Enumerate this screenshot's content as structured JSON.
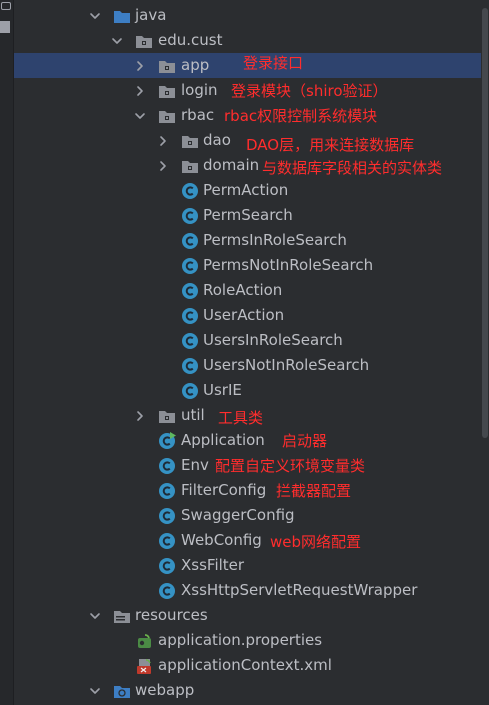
{
  "tree": {
    "java": "java",
    "edu_cust": "edu.cust",
    "app": "app",
    "login": "login",
    "rbac": "rbac",
    "dao": "dao",
    "domain": "domain",
    "rbac_classes": [
      "PermAction",
      "PermSearch",
      "PermsInRoleSearch",
      "PermsNotInRoleSearch",
      "RoleAction",
      "UserAction",
      "UsersInRoleSearch",
      "UsersNotInRoleSearch",
      "UsrIE"
    ],
    "util": "util",
    "application": "Application",
    "env": "Env",
    "filterconfig": "FilterConfig",
    "swaggerconfig": "SwaggerConfig",
    "webconfig": "WebConfig",
    "xssfilter": "XssFilter",
    "xsswrapper": "XssHttpServletRequestWrapper",
    "resources": "resources",
    "app_props": "application.properties",
    "app_ctx": "applicationContext.xml",
    "webapp": "webapp"
  },
  "annotations": {
    "app": "登录接口",
    "login": "登录模块（shiro验证）",
    "rbac": "rbac权限控制系统模块",
    "dao": "DAO层，用来连接数据库",
    "domain": "与数据库字段相关的实体类",
    "util": "工具类",
    "application": "启动器",
    "env": "配置自定义环境变量类",
    "filterconfig": "拦截器配置",
    "webconfig": "web网络配置"
  },
  "colors": {
    "background": "#2b2d30",
    "selection": "#2e436e",
    "annotation": "#ff2d2d",
    "class_icon": "#3592c4",
    "folder_icon": "#9da0a8",
    "source_folder_icon": "#5a9ed6"
  }
}
